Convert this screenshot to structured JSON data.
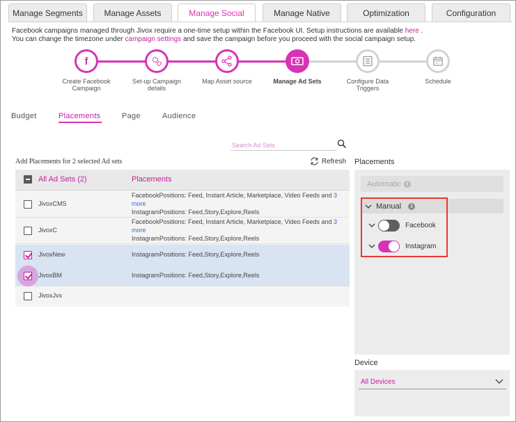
{
  "tabs": [
    {
      "label": "Manage Segments",
      "active": false
    },
    {
      "label": "Manage Assets",
      "active": false
    },
    {
      "label": "Manage Social",
      "active": true
    },
    {
      "label": "Manage Native",
      "active": false
    },
    {
      "label": "Optimization",
      "active": false
    },
    {
      "label": "Configuration",
      "active": false
    }
  ],
  "intro": {
    "line1_text": "Facebook campaigns managed through Jivox require a one-time setup within the Facebook UI. Setup instructions are available",
    "line1_link": "here",
    "line1_end": ".",
    "line2_start": "You can change the timezone under",
    "line2_link": "campaign settings",
    "line2_end": "and save the campaign before you proceed with the social campaign setup."
  },
  "stepper": [
    {
      "label": "Create Facebook Campaign",
      "icon": "facebook-icon",
      "state": "done"
    },
    {
      "label": "Set-up Campaign details",
      "icon": "gears-icon",
      "state": "done"
    },
    {
      "label": "Map Asset source",
      "icon": "network-icon",
      "state": "done"
    },
    {
      "label": "Manage Ad Sets",
      "icon": "money-icon",
      "state": "current"
    },
    {
      "label": "Configure Data Triggers",
      "icon": "list-icon",
      "state": "todo"
    },
    {
      "label": "Schedule",
      "icon": "calendar-icon",
      "state": "todo"
    }
  ],
  "subtabs": [
    {
      "label": "Budget",
      "active": false
    },
    {
      "label": "Placements",
      "active": true
    },
    {
      "label": "Page",
      "active": false
    },
    {
      "label": "Audience",
      "active": false
    }
  ],
  "search": {
    "placeholder": "Search Ad Sets"
  },
  "add_heading": "Add Placements for 2 selected Ad sets",
  "refresh_label": "Refresh",
  "table": {
    "header_col1": "All Ad Sets (2)",
    "header_col2": "Placements",
    "rows": [
      {
        "name": "JivoxCMS",
        "checked": false,
        "fb": "FacebookPositions: Feed, Instant Article, Marketplace, Video Feeds and",
        "more": "3 more",
        "ig": "InstagramPositions: Feed,Story,Explore,Reels"
      },
      {
        "name": "JivoxC",
        "checked": false,
        "fb": "FacebookPositions: Feed, Instant Article, Marketplace, Video Feeds and",
        "more": "3 more",
        "ig": "InstagramPositions: Feed,Story,Explore,Reels"
      },
      {
        "name": "JivoxNew",
        "checked": true,
        "ig": "InstagramPositions: Feed,Story,Explore,Reels"
      },
      {
        "name": "JivoxBM",
        "checked": true,
        "ig": "InstagramPositions: Feed,Story,Explore,Reels"
      },
      {
        "name": "JivoxJvx",
        "checked": false
      }
    ]
  },
  "placements_panel": {
    "title": "Placements",
    "automatic_label": "Automatic",
    "manual_label": "Manual",
    "facebook_label": "Facebook",
    "facebook_on": false,
    "instagram_label": "Instagram",
    "instagram_on": true
  },
  "device": {
    "title": "Device",
    "selected": "All Devices"
  },
  "colors": {
    "accent": "#d633b6",
    "highlight_border": "#e53a2c",
    "selected_row": "#d8e4f2"
  }
}
